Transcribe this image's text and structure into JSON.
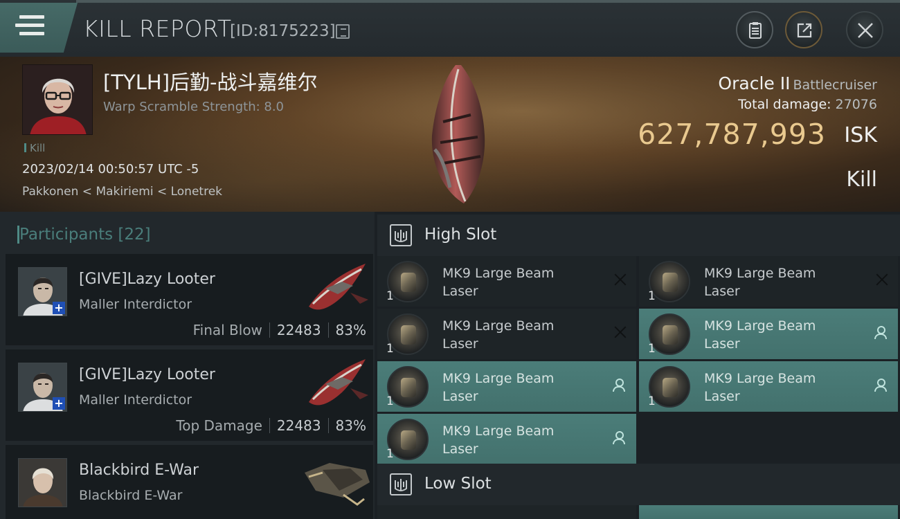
{
  "header": {
    "title": "KILL REPORT",
    "id_text": "[ID:8175223]",
    "buttons": [
      "report",
      "share",
      "close"
    ]
  },
  "victim": {
    "name": "[TYLH]后勤-战斗嘉维尔",
    "warp_scramble": "Warp Scramble Strength: 8.0",
    "kill_tag": "Kill",
    "timestamp": "2023/02/14 00:50:57 UTC -5",
    "location": "Pakkonen < Makiriemi < Lonetrek",
    "ship_name": "Oracle II",
    "ship_class": "Battlecruiser",
    "total_damage_label": "Total damage:",
    "total_damage": "27076",
    "isk_value": "627,787,993",
    "isk_unit": "ISK",
    "result": "Kill"
  },
  "participants": {
    "label": "Participants",
    "count": "[22]",
    "items": [
      {
        "name": "[GIVE]Lazy Looter",
        "ship": "Maller Interdictor",
        "tag": "Final Blow",
        "damage": "22483",
        "percent": "83%"
      },
      {
        "name": "[GIVE]Lazy Looter",
        "ship": "Maller Interdictor",
        "tag": "Top Damage",
        "damage": "22483",
        "percent": "83%"
      },
      {
        "name": "Blackbird E-War",
        "ship": "Blackbird E-War"
      }
    ]
  },
  "slots": {
    "high_title": "High Slot",
    "low_title": "Low Slot",
    "high_modules": [
      {
        "name": "MK9 Large Beam Laser",
        "qty": "1",
        "status": "destroyed"
      },
      {
        "name": "MK9 Large Beam Laser",
        "qty": "1",
        "status": "destroyed"
      },
      {
        "name": "MK9 Large Beam Laser",
        "qty": "1",
        "status": "destroyed"
      },
      {
        "name": "MK9 Large Beam Laser",
        "qty": "1",
        "status": "dropped"
      },
      {
        "name": "MK9 Large Beam Laser",
        "qty": "1",
        "status": "dropped"
      },
      {
        "name": "MK9 Large Beam Laser",
        "qty": "1",
        "status": "dropped"
      },
      {
        "name": "MK9 Large Beam Laser",
        "qty": "1",
        "status": "dropped"
      }
    ]
  },
  "colors": {
    "accent_teal": "#4f8b86",
    "isk_gold": "#e9c98f",
    "dropped_bg": "#4b7d79"
  }
}
